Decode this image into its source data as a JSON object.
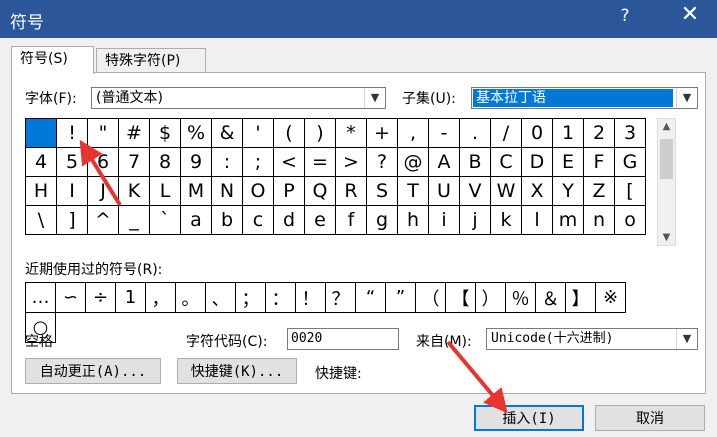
{
  "window": {
    "title": "符号",
    "help": "?",
    "close": "✕"
  },
  "tabs": [
    {
      "label": "符号(S)"
    },
    {
      "label": "特殊字符(P)"
    }
  ],
  "font": {
    "label": "字体(F):",
    "value": "(普通文本)"
  },
  "subset": {
    "label": "子集(U):",
    "value": "基本拉丁语"
  },
  "symbols": [
    " ",
    "!",
    "\"",
    "#",
    "$",
    "%",
    "&",
    "'",
    "(",
    ")",
    "*",
    "+",
    ",",
    "-",
    ".",
    "/",
    "0",
    "1",
    "2",
    "3",
    "4",
    "5",
    "6",
    "7",
    "8",
    "9",
    ":",
    ";",
    "<",
    "=",
    ">",
    "?",
    "@",
    "A",
    "B",
    "C",
    "D",
    "E",
    "F",
    "G",
    "H",
    "I",
    "J",
    "K",
    "L",
    "M",
    "N",
    "O",
    "P",
    "Q",
    "R",
    "S",
    "T",
    "U",
    "V",
    "W",
    "X",
    "Y",
    "Z",
    "[",
    "\\",
    "]",
    "^",
    "_",
    "`",
    "a",
    "b",
    "c",
    "d",
    "e",
    "f",
    "g",
    "h",
    "i",
    "j",
    "k",
    "l",
    "m",
    "n",
    "o"
  ],
  "recent": {
    "label": "近期使用过的符号(R):",
    "symbols": [
      "…",
      "∽",
      "÷",
      "1",
      "，",
      "。",
      "、",
      "；",
      "：",
      "！",
      "？",
      "“",
      "”",
      "（",
      "【",
      "）",
      "％",
      "＆",
      "】",
      "※",
      "○"
    ]
  },
  "char_name": "空格",
  "char_code": {
    "label": "字符代码(C):",
    "value": "0020"
  },
  "from": {
    "label": "来自(M):",
    "value": "Unicode(十六进制)"
  },
  "buttons": {
    "autocorrect": "自动更正(A)...",
    "shortcut_key": "快捷键(K)...",
    "shortcut_label": "快捷键:",
    "insert": "插入(I)",
    "cancel": "取消"
  }
}
